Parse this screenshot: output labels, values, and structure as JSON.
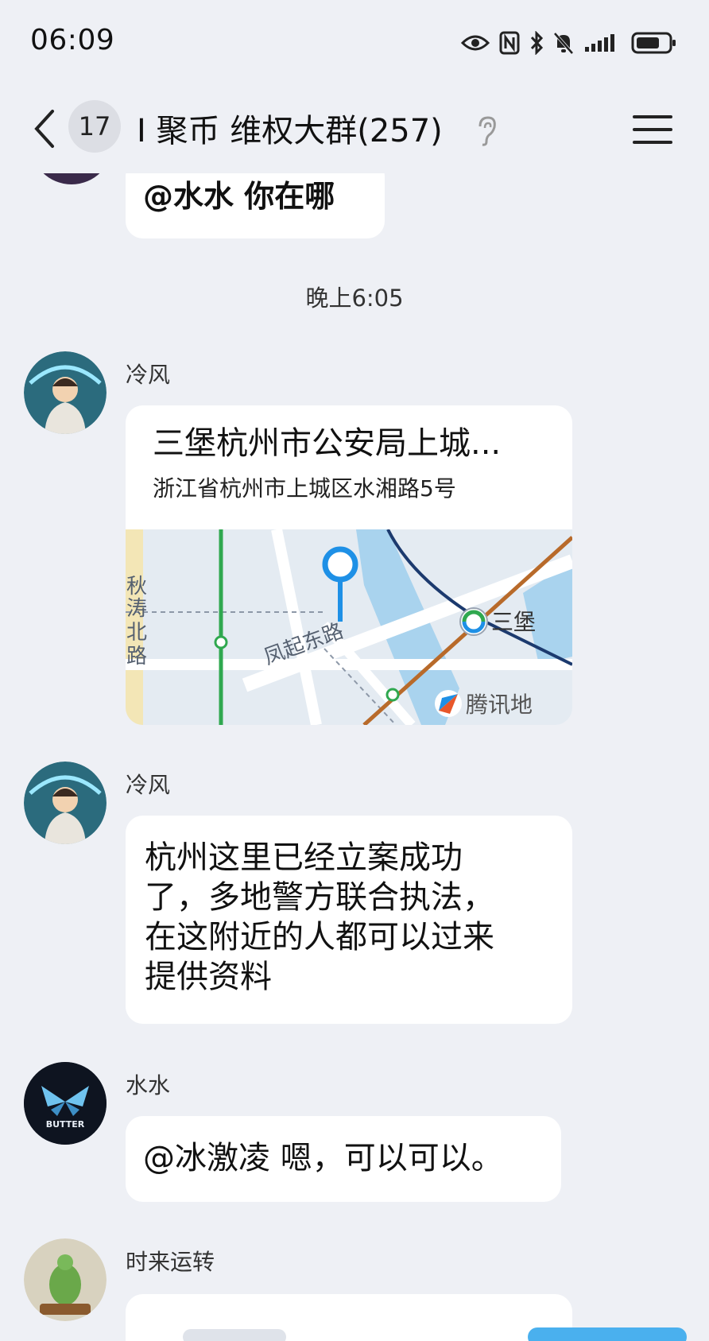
{
  "status_bar": {
    "time": "06:09"
  },
  "header": {
    "back_label": "<",
    "unread_count": "17",
    "title": "I 聚币 维权大群(257)"
  },
  "messages": {
    "msg1": {
      "text": "@水水 你在哪"
    },
    "timestamp": "晚上6:05",
    "msg2": {
      "sender": "冷风",
      "location_title": "三堡杭州市公安局上城...",
      "location_address": "浙江省杭州市上城区水湘路5号",
      "map_labels": {
        "road_vertical": [
          "秋",
          "涛",
          "北",
          "路"
        ],
        "road_diagonal": "凤起东路",
        "station": "三堡",
        "provider": "腾讯地"
      }
    },
    "msg3": {
      "sender": "冷风",
      "lines": [
        "杭州这里已经立案成功",
        "了，多地警方联合执法，",
        "在这附近的人都可以过来",
        "提供资料"
      ]
    },
    "msg4": {
      "sender": "水水",
      "avatar_text": "BUTTER",
      "text": "@冰激凌 嗯，可以可以。"
    },
    "msg5": {
      "sender": "时来运转"
    }
  },
  "colors": {
    "background": "#eef0f5",
    "bubble": "#ffffff",
    "map_pin": "#1e90e6",
    "metro_green": "#2fa84f",
    "metro_brown": "#b86a2a",
    "metro_navy": "#1c3a6e",
    "river": "#a9d3ee"
  }
}
